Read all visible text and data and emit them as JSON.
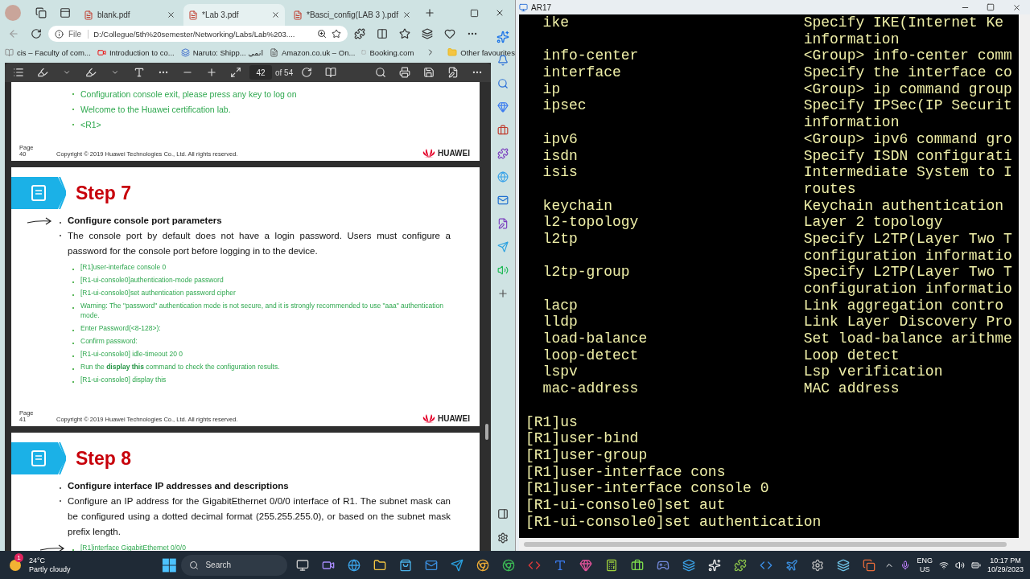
{
  "browser": {
    "tabs": [
      {
        "title": "blank.pdf",
        "selected": false
      },
      {
        "title": "*Lab 3.pdf",
        "selected": true
      },
      {
        "title": "*Basci_config(LAB 3 ).pdf",
        "selected": false
      }
    ],
    "address": {
      "scheme": "File",
      "url": "D:/Collegue/5th%20semester/Networking/Labs/Lab%203...."
    },
    "bookmarks": [
      {
        "label": "cis – Faculty of com..."
      },
      {
        "label": "Introduction to co..."
      },
      {
        "label": "Naruto: Shipp... انمي"
      },
      {
        "label": "Amazon.co.uk – On..."
      },
      {
        "label": "Booking.com"
      }
    ],
    "other_favourites": "Other favourites",
    "pdf_toolbar": {
      "page": "42",
      "total": "of 54"
    }
  },
  "pdf_pages": [
    {
      "kind": "tail",
      "items": [
        {
          "kind": "command",
          "text": "Configuration console exit, please press any key to log on"
        },
        {
          "kind": "command",
          "text": "Welcome to the Huawei certification lab."
        },
        {
          "kind": "command",
          "text": "<R1>"
        }
      ],
      "footer": {
        "page": "Page",
        "number": "40",
        "copyright": "Copyright © 2019 Huawei Technologies Co., Ltd. All rights reserved.",
        "logo": "HUAWEI"
      }
    },
    {
      "kind": "step",
      "step": "Step 7",
      "items": [
        {
          "kind": "heading",
          "text": "**Configure console port parameters**",
          "arrow": true
        },
        {
          "kind": "body",
          "text": "The console port by default does not have a login password. Users must configure a password for the console port before logging in to the device."
        },
        {
          "kind": "command",
          "text": "[R1]user-interface console 0"
        },
        {
          "kind": "command",
          "text": "[R1-ui-console0]authentication-mode password"
        },
        {
          "kind": "command",
          "text": "[R1-ui-console0]set authentication password cipher"
        },
        {
          "kind": "command",
          "text": "Warning: The \"password\" authentication mode is not secure, and it is strongly recommended to use \"aaa\" authentication mode."
        },
        {
          "kind": "command",
          "text": "Enter Password(<8-128>):"
        },
        {
          "kind": "command",
          "text": "Confirm password:"
        },
        {
          "kind": "command",
          "text": "[R1-ui-console0] idle-timeout 20 0"
        },
        {
          "kind": "command",
          "text": "Run the **display this** command to check the configuration results."
        },
        {
          "kind": "command",
          "text": "[R1-ui-console0] display this"
        }
      ],
      "footer": {
        "page": "Page",
        "number": "41",
        "copyright": "Copyright © 2019 Huawei Technologies Co., Ltd. All rights reserved.",
        "logo": "HUAWEI"
      }
    },
    {
      "kind": "step",
      "step": "Step 8",
      "items": [
        {
          "kind": "heading",
          "text": "**Configure interface IP addresses and descriptions**"
        },
        {
          "kind": "body",
          "text": "Configure an IP address for the GigabitEthernet 0/0/0 interface of R1. The subnet mask can be configured using a dotted decimal format (255.255.255.0), or based on the subnet mask prefix length."
        },
        {
          "kind": "command",
          "text": "[R1]interface GigabitEthernet 0/0/0",
          "arrow": true
        }
      ]
    }
  ],
  "terminal": {
    "title": "AR17",
    "lines": [
      {
        "kind": "help",
        "command": "ike",
        "description": "Specify IKE(Internet Ke"
      },
      {
        "kind": "help",
        "description": "information"
      },
      {
        "kind": "help",
        "command": "info-center",
        "description": "<Group> info-center comm"
      },
      {
        "kind": "help",
        "command": "interface",
        "description": "Specify the interface co"
      },
      {
        "kind": "help",
        "command": "ip",
        "description": "<Group> ip command group"
      },
      {
        "kind": "help",
        "command": "ipsec",
        "description": "Specify IPSec(IP Securit"
      },
      {
        "kind": "help",
        "description": "information"
      },
      {
        "kind": "help",
        "command": "ipv6",
        "description": "<Group> ipv6 command gro"
      },
      {
        "kind": "help",
        "command": "isdn",
        "description": "Specify ISDN configurati"
      },
      {
        "kind": "help",
        "command": "isis",
        "description": "Intermediate System to I"
      },
      {
        "kind": "help",
        "description": "routes"
      },
      {
        "kind": "help",
        "command": "keychain",
        "description": "Keychain authentication"
      },
      {
        "kind": "help",
        "command": "l2-topology",
        "description": "Layer 2 topology"
      },
      {
        "kind": "help",
        "command": "l2tp",
        "description": "Specify L2TP(Layer Two T"
      },
      {
        "kind": "help",
        "description": "configuration informatio"
      },
      {
        "kind": "help",
        "command": "l2tp-group",
        "description": "Specify L2TP(Layer Two T"
      },
      {
        "kind": "help",
        "description": "configuration informatio"
      },
      {
        "kind": "help",
        "command": "lacp",
        "description": "Link aggregation contro"
      },
      {
        "kind": "help",
        "command": "lldp",
        "description": "Link Layer Discovery Pro"
      },
      {
        "kind": "help",
        "command": "load-balance",
        "description": "Set load-balance arithme"
      },
      {
        "kind": "help",
        "command": "loop-detect",
        "description": "Loop detect"
      },
      {
        "kind": "help",
        "command": "lspv",
        "description": "Lsp verification"
      },
      {
        "kind": "help",
        "command": "mac-address",
        "description": "MAC address"
      },
      {
        "kind": "blank"
      },
      {
        "kind": "prompt",
        "text": "[R1]us"
      },
      {
        "kind": "prompt",
        "text": "[R1]user-bind"
      },
      {
        "kind": "prompt",
        "text": "[R1]user-group"
      },
      {
        "kind": "prompt",
        "text": "[R1]user-interface cons"
      },
      {
        "kind": "prompt",
        "text": "[R1]user-interface console 0"
      },
      {
        "kind": "prompt",
        "text": "[R1-ui-console0]set aut"
      },
      {
        "kind": "prompt",
        "text": "[R1-ui-console0]set authentication"
      }
    ]
  },
  "taskbar": {
    "weather": {
      "badge": "1",
      "temp": "24°C",
      "condition": "Partly cloudy"
    },
    "search": "Search",
    "tray": {
      "lang": "ENG",
      "region": "US",
      "time": "10:17 PM",
      "date": "10/29/2023"
    }
  }
}
